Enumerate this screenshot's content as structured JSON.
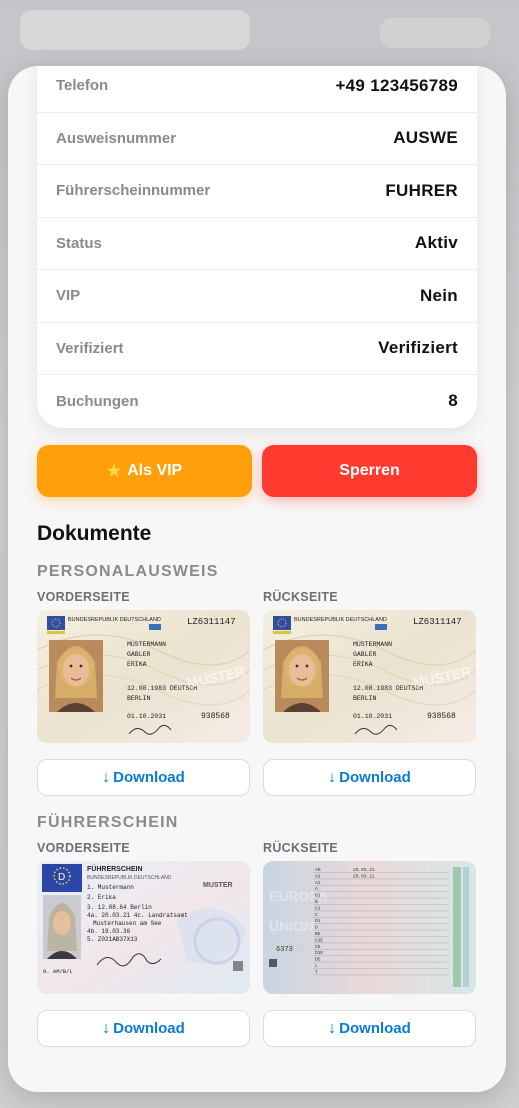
{
  "info": [
    {
      "label": "Telefon",
      "value": "+49 123456789"
    },
    {
      "label": "Ausweisnummer",
      "value": "AUSWE"
    },
    {
      "label": "Führerscheinnummer",
      "value": "FUHRER"
    },
    {
      "label": "Status",
      "value": "Aktiv"
    },
    {
      "label": "VIP",
      "value": "Nein"
    },
    {
      "label": "Verifiziert",
      "value": "Verifiziert"
    },
    {
      "label": "Buchungen",
      "value": "8"
    }
  ],
  "actions": {
    "vip_label": "Als VIP",
    "vip_icon": "star-icon",
    "lock_label": "Sperren"
  },
  "documents": {
    "title": "Dokumente",
    "personalausweis": {
      "title": "PERSONALAUSWEIS",
      "front_label": "VORDERSEITE",
      "back_label": "RÜCKSEITE",
      "front_card": {
        "header": "BUNDESREPUBLIK DEUTSCHLAND",
        "number": "LZ6311147",
        "surname": "MUSTERMANN",
        "birthname": "GABLER",
        "given": "ERIKA",
        "dob": "12.08.1983 DEUTSCH",
        "place": "BERLIN",
        "expiry": "01.10.2031",
        "can": "938568",
        "stamp": "MUSTER"
      },
      "back_card": {
        "header": "BUNDESREPUBLIK DEUTSCHLAND",
        "number": "LZ6311147",
        "surname": "MUSTERMANN",
        "birthname": "GABLER",
        "given": "ERIKA",
        "dob": "12.08.1983 DEUTSCH",
        "place": "BERLIN",
        "expiry": "01.10.2031",
        "can": "938568",
        "stamp": "MUSTER"
      }
    },
    "fuehrerschein": {
      "title": "FÜHRERSCHEIN",
      "front_label": "VORDERSEITE",
      "back_label": "RÜCKSEITE",
      "front_card": {
        "header": "FÜHRERSCHEIN",
        "country": "BUNDESREPUBLIK DEUTSCHLAND",
        "code": "D",
        "line1": "1. Mustermann",
        "line2": "2. Erika",
        "line3": "3. 12.08.64 Berlin",
        "line4": "4a. 20.03.21 4c. Landratsamt",
        "line5": "Musterhausen am See",
        "line6": "4b. 19.03.36",
        "line7": "5. Z021AB37X13",
        "classes": "9. AM/B/L",
        "stamp": "MUSTER"
      },
      "back_card": {
        "rows": [
          "AM",
          "A1",
          "A2",
          "A",
          "B1",
          "B",
          "C1",
          "C",
          "D1",
          "D",
          "BE",
          "C1E",
          "CE",
          "D1E",
          "DE",
          "L",
          "T"
        ],
        "date": "20.03.21",
        "code": "6373"
      }
    },
    "download_label": "Download",
    "download_icon": "down-arrow-icon"
  },
  "colors": {
    "vip": "#ff9f0a",
    "lock": "#ff3b30",
    "link": "#0a7ad8"
  }
}
